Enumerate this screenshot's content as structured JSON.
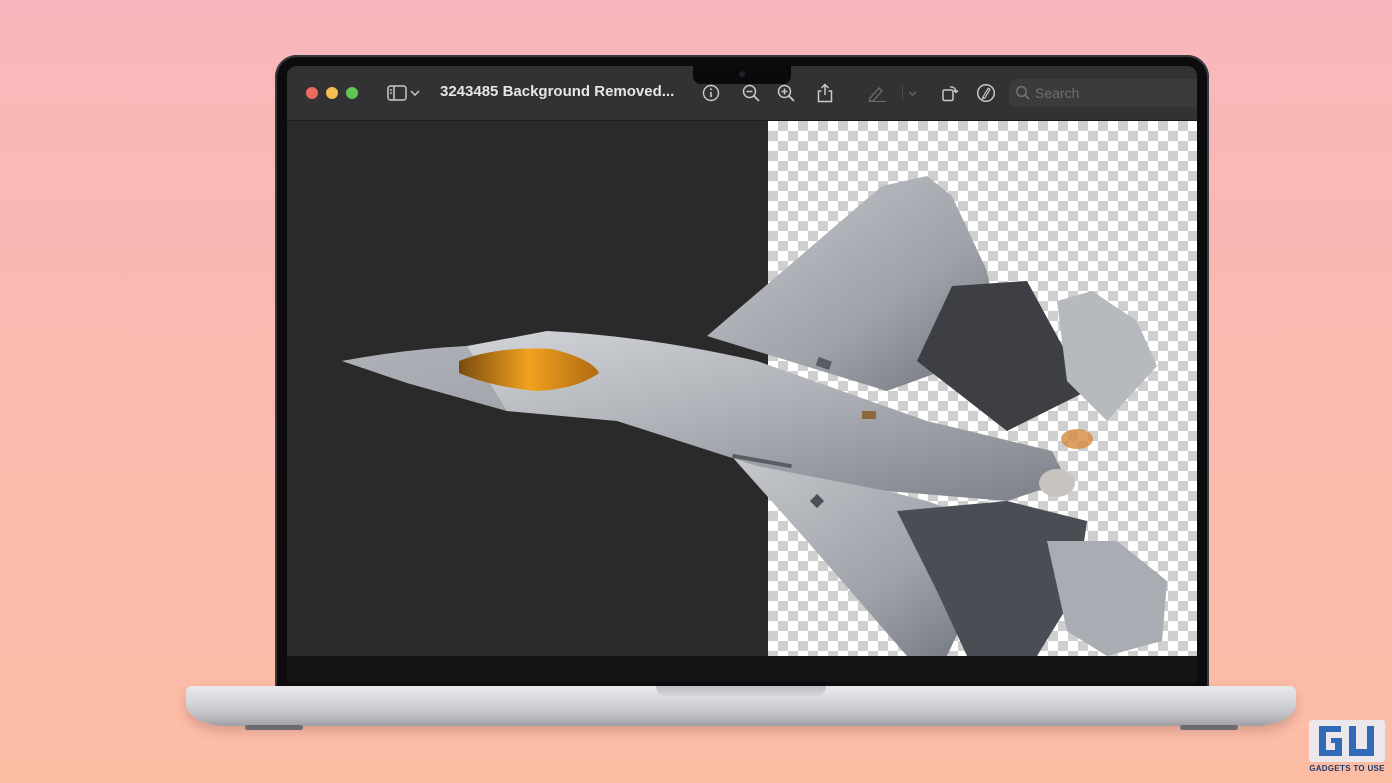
{
  "window": {
    "title": "3243485 Background Removed...",
    "traffic_lights": {
      "close_color": "#ed6a5e",
      "minimize_color": "#f4bf4f",
      "zoom_color": "#61c554"
    }
  },
  "toolbar": {
    "icons": [
      "sidebar-icon",
      "chevron-down-icon",
      "info-icon",
      "zoom-out-icon",
      "zoom-in-icon",
      "share-icon",
      "highlight-pen-icon",
      "chevron-down-icon",
      "rotate-icon",
      "markup-icon",
      "search-icon"
    ],
    "search": {
      "placeholder": "Search",
      "value": ""
    }
  },
  "canvas": {
    "left_background": "#2a2a2a",
    "transparency_pattern": "checkerboard",
    "subject": "fighter-jet"
  },
  "watermark": {
    "logo_letters": "GU",
    "tagline": "GADGETS TO USE"
  }
}
